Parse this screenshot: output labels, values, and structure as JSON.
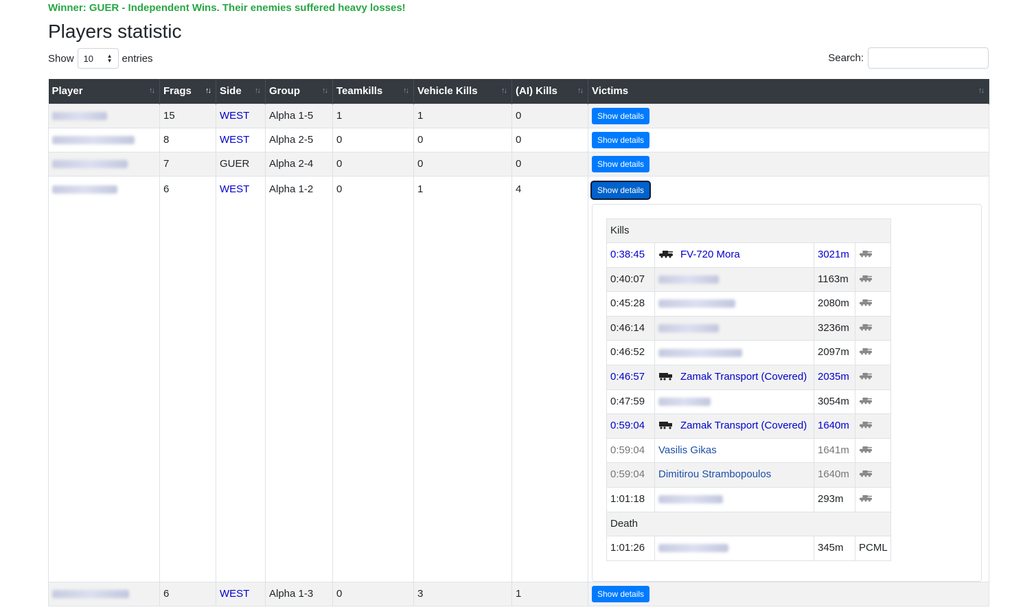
{
  "winner_text": "Winner: GUER - Independent Wins. Their enemies suffered heavy losses!",
  "page_title": "Players statistic",
  "length_control": {
    "show_label": "Show",
    "value": "10",
    "entries_label": "entries"
  },
  "search": {
    "label": "Search:",
    "value": ""
  },
  "columns": [
    "Player",
    "Frags",
    "Side",
    "Group",
    "Teamkills",
    "Vehicle Kills",
    "(AI) Kills",
    "Victims"
  ],
  "details_button_label": "Show details",
  "rows": [
    {
      "frags": "15",
      "side": "WEST",
      "group": "Alpha 1-5",
      "teamkills": "1",
      "vehicle_kills": "1",
      "ai_kills": "0"
    },
    {
      "frags": "8",
      "side": "WEST",
      "group": "Alpha 2-5",
      "teamkills": "0",
      "vehicle_kills": "0",
      "ai_kills": "0"
    },
    {
      "frags": "7",
      "side": "GUER",
      "group": "Alpha 2-4",
      "teamkills": "0",
      "vehicle_kills": "0",
      "ai_kills": "0"
    },
    {
      "frags": "6",
      "side": "WEST",
      "group": "Alpha 1-2",
      "teamkills": "0",
      "vehicle_kills": "1",
      "ai_kills": "4"
    },
    {
      "frags": "6",
      "side": "WEST",
      "group": "Alpha 1-3",
      "teamkills": "0",
      "vehicle_kills": "3",
      "ai_kills": "1"
    }
  ],
  "details": {
    "kills_label": "Kills",
    "death_label": "Death",
    "kills": [
      {
        "time": "0:38:45",
        "victim": "FV-720 Mora",
        "distance": "3021m",
        "kind": "vehicle",
        "icon": "tank-icon"
      },
      {
        "time": "0:40:07",
        "victim": "",
        "distance": "1163m",
        "kind": "player"
      },
      {
        "time": "0:45:28",
        "victim": "",
        "distance": "2080m",
        "kind": "player"
      },
      {
        "time": "0:46:14",
        "victim": "",
        "distance": "3236m",
        "kind": "player"
      },
      {
        "time": "0:46:52",
        "victim": "",
        "distance": "2097m",
        "kind": "player"
      },
      {
        "time": "0:46:57",
        "victim": "Zamak Transport (Covered)",
        "distance": "2035m",
        "kind": "vehicle",
        "icon": "truck-icon"
      },
      {
        "time": "0:47:59",
        "victim": "",
        "distance": "3054m",
        "kind": "player"
      },
      {
        "time": "0:59:04",
        "victim": "Zamak Transport (Covered)",
        "distance": "1640m",
        "kind": "vehicle",
        "icon": "truck-icon"
      },
      {
        "time": "0:59:04",
        "victim": "Vasilis Gikas",
        "distance": "1641m",
        "kind": "ai"
      },
      {
        "time": "0:59:04",
        "victim": "Dimitirou Strambopoulos",
        "distance": "1640m",
        "kind": "ai"
      },
      {
        "time": "1:01:18",
        "victim": "",
        "distance": "293m",
        "kind": "player"
      }
    ],
    "death": {
      "time": "1:01:26",
      "killer": "",
      "distance": "345m",
      "weapon": "PCML"
    }
  }
}
